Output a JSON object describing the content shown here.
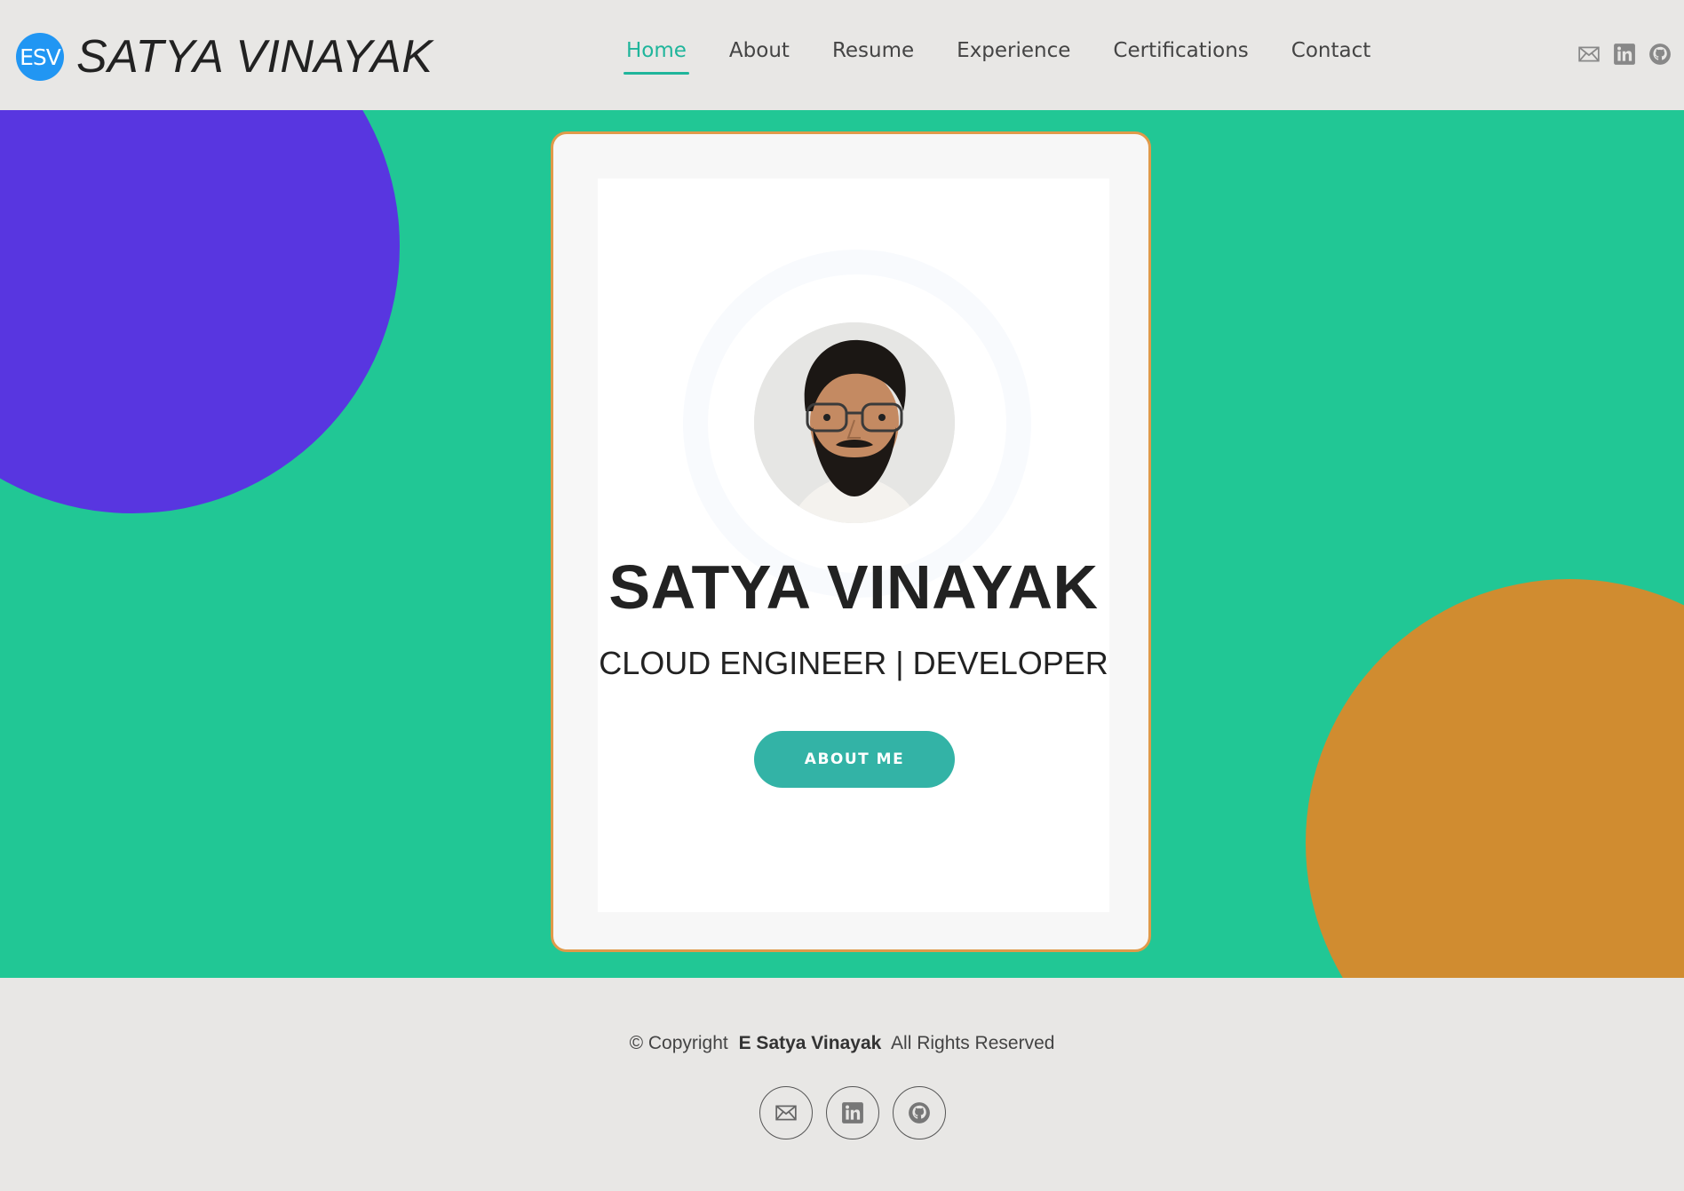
{
  "brand": {
    "badge": "ESV",
    "title": "SATYA VINAYAK"
  },
  "nav": {
    "items": [
      {
        "label": "Home",
        "active": true
      },
      {
        "label": "About"
      },
      {
        "label": "Resume"
      },
      {
        "label": "Experience"
      },
      {
        "label": "Certifications"
      },
      {
        "label": "Contact"
      }
    ]
  },
  "header_social": [
    "envelope-icon",
    "linkedin-icon",
    "github-icon"
  ],
  "hero": {
    "name": "SATYA VINAYAK",
    "role": "CLOUD ENGINEER | DEVELOPER",
    "button_label": "ABOUT ME"
  },
  "footer": {
    "copyright_prefix": "© Copyright",
    "owner": "E Satya Vinayak",
    "rights": "All Rights Reserved",
    "social": [
      "envelope-icon",
      "linkedin-icon",
      "github-icon"
    ]
  },
  "colors": {
    "accent": "#1fb59b",
    "hero_bg": "#21c795",
    "purple_circle": "#5836e0",
    "orange_circle": "#d08c30",
    "button": "#33b3a6",
    "logo_badge": "#2196f3"
  }
}
